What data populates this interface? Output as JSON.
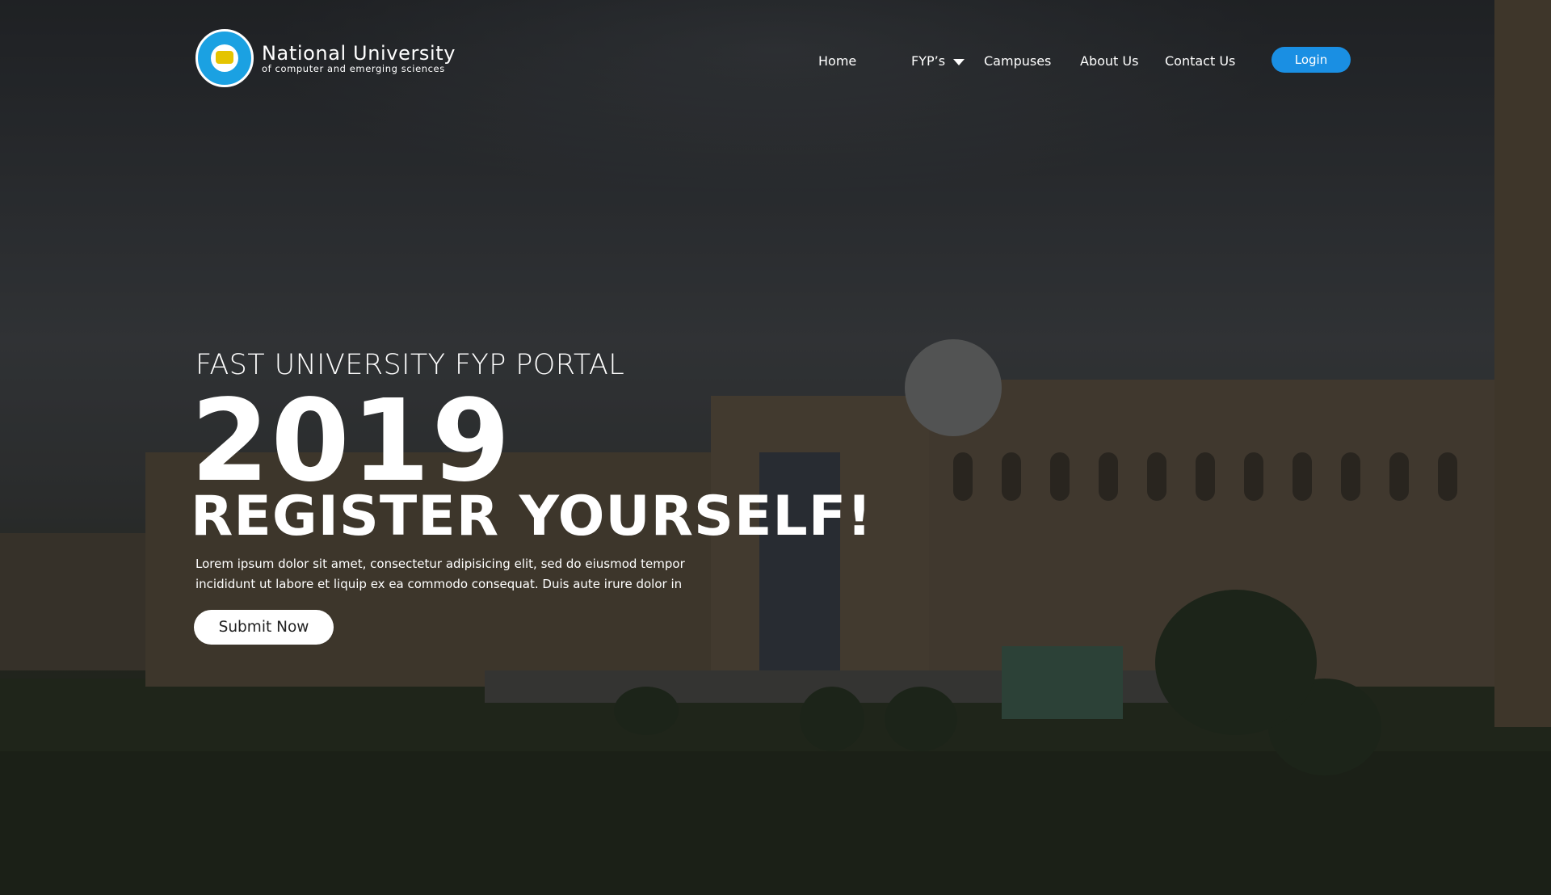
{
  "header": {
    "logo": {
      "title": "National University",
      "subtitle": "of computer and emerging sciences"
    },
    "nav": {
      "home": "Home",
      "fyps": "FYP’s",
      "campuses": "Campuses",
      "about": "About Us",
      "contact": "Contact Us"
    },
    "login_label": "Login"
  },
  "hero": {
    "kicker": "FAST UNIVERSITY FYP PORTAL",
    "year": "2019",
    "headline": "REGISTER YOURSELF!",
    "description_line1": "Lorem ipsum dolor sit amet, consectetur adipisicing elit, sed do eiusmod tempor",
    "description_line2": "incididunt ut labore et liquip ex ea commodo consequat. Duis aute irure dolor in",
    "cta_label": "Submit Now"
  },
  "colors": {
    "accent": "#1a8fe3",
    "text": "#ffffff",
    "logo_blue": "#1ba1e2"
  },
  "icons": {
    "dropdown": "chevron-down-icon",
    "logo": "university-seal-icon"
  }
}
